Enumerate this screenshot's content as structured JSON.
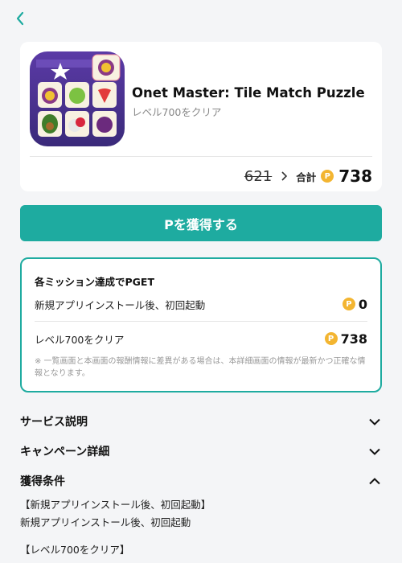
{
  "app": {
    "name": "Onet Master: Tile Match Puzzle",
    "subtitle": "レベル700をクリア",
    "old_points": "621",
    "total_label": "合計",
    "total_points": "738",
    "coin_glyph": "P"
  },
  "cta": {
    "label": "Pを獲得する"
  },
  "missions": {
    "title": "各ミッション達成でPGET",
    "items": [
      {
        "label": "新規アプリインストール後、初回起動",
        "points": "0"
      },
      {
        "label": "レベル700をクリア",
        "points": "738"
      }
    ],
    "note": "※ 一覧画面と本画面の報酬情報に差異がある場合は、本詳細画面の情報が最新かつ正確な情報となります。"
  },
  "sections": [
    {
      "label": "サービス説明",
      "icon": "chevron-down-icon"
    },
    {
      "label": "キャンペーン詳細",
      "icon": "chevron-down-icon"
    },
    {
      "label": "獲得条件",
      "icon": "chevron-up-icon"
    }
  ],
  "conditions": {
    "line1": "【新規アプリインストール後、初回起動】",
    "line2": "新規アプリインストール後、初回起動",
    "line3": "【レベル700をクリア】"
  },
  "colors": {
    "accent": "#1eaba0",
    "coin": "#f3b531"
  }
}
